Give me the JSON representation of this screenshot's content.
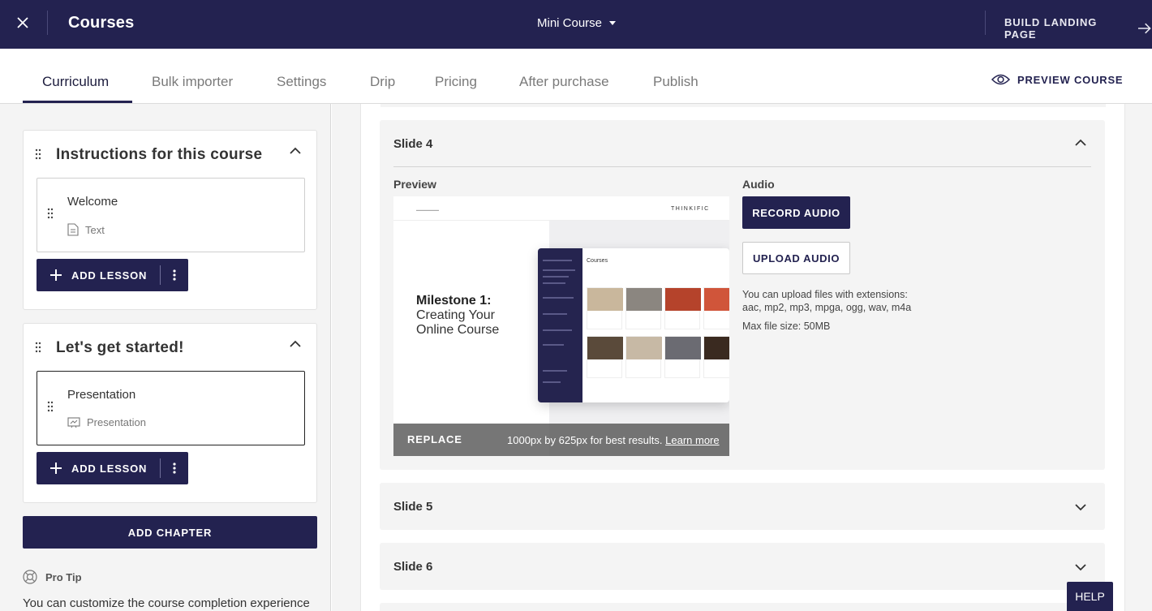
{
  "topbar": {
    "title": "Courses",
    "course_select": "Mini Course",
    "build_landing": "BUILD LANDING PAGE"
  },
  "tabs": [
    "Curriculum",
    "Bulk importer",
    "Settings",
    "Drip",
    "Pricing",
    "After purchase",
    "Publish"
  ],
  "active_tab": "Curriculum",
  "preview_course": "PREVIEW COURSE",
  "chapters": [
    {
      "title": "Instructions for this course",
      "lesson": {
        "name": "Welcome",
        "type": "Text"
      },
      "add_lesson": "ADD LESSON"
    },
    {
      "title": "Let's get started!",
      "lesson": {
        "name": "Presentation",
        "type": "Presentation"
      },
      "add_lesson": "ADD LESSON"
    }
  ],
  "add_chapter": "ADD CHAPTER",
  "pro_tip": {
    "label": "Pro Tip",
    "text": "You can customize the course completion experience"
  },
  "slides": {
    "expanded": {
      "title": "Slide 4",
      "preview_label": "Preview",
      "audio_label": "Audio",
      "record_audio": "RECORD AUDIO",
      "upload_audio": "UPLOAD AUDIO",
      "upload_info_line1": "You can upload files with extensions:",
      "upload_info_line2": "aac, mp2, mp3, mpga, ogg, wav, m4a",
      "max_size": "Max file size: 50MB",
      "replace": "REPLACE",
      "size_hint": "1000px by 625px for best results.",
      "learn_more": "Learn more",
      "thumbnail": {
        "brand": "THINKIFIC",
        "heading": "Milestone 1:",
        "subheading_1": "Creating Your",
        "subheading_2": "Online Course",
        "app_title": "Courses"
      }
    },
    "collapsed": [
      "Slide 5",
      "Slide 6"
    ]
  },
  "help": "HELP",
  "colors": {
    "navy": "#232250",
    "panel_bg": "#f4f4f4"
  }
}
